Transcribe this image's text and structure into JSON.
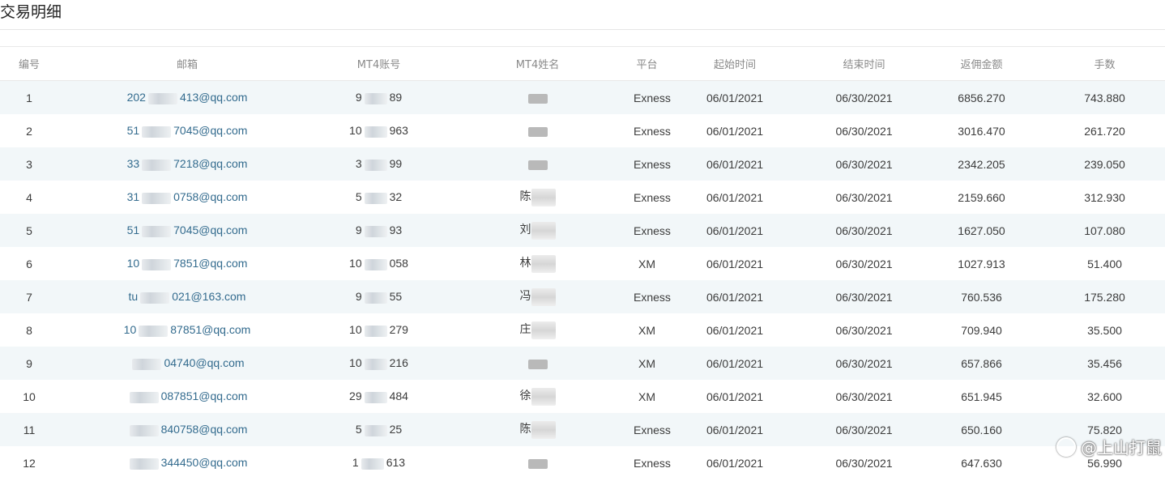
{
  "page": {
    "title": "交易明细"
  },
  "table": {
    "columns": [
      "编号",
      "邮箱",
      "MT4账号",
      "MT4姓名",
      "平台",
      "起始时间",
      "结束时间",
      "返佣金额",
      "手数"
    ],
    "rows": [
      {
        "id": "1",
        "email_start": "202",
        "email_end": "413@qq.com",
        "account_start": "9",
        "account_end": "89",
        "name_start": "",
        "name_end": "",
        "platform": "Exness",
        "start": "06/01/2021",
        "end": "06/30/2021",
        "rebate": "6856.270",
        "lots": "743.880"
      },
      {
        "id": "2",
        "email_start": "51",
        "email_end": "7045@qq.com",
        "account_start": "10",
        "account_end": "963",
        "name_start": "",
        "name_end": "",
        "platform": "Exness",
        "start": "06/01/2021",
        "end": "06/30/2021",
        "rebate": "3016.470",
        "lots": "261.720"
      },
      {
        "id": "3",
        "email_start": "33",
        "email_end": "7218@qq.com",
        "account_start": "3",
        "account_end": "99",
        "name_start": "",
        "name_end": "",
        "platform": "Exness",
        "start": "06/01/2021",
        "end": "06/30/2021",
        "rebate": "2342.205",
        "lots": "239.050"
      },
      {
        "id": "4",
        "email_start": "31",
        "email_end": "0758@qq.com",
        "account_start": "5",
        "account_end": "32",
        "name_start": "陈",
        "name_end": "",
        "platform": "Exness",
        "start": "06/01/2021",
        "end": "06/30/2021",
        "rebate": "2159.660",
        "lots": "312.930"
      },
      {
        "id": "5",
        "email_start": "51",
        "email_end": "7045@qq.com",
        "account_start": "9",
        "account_end": "93",
        "name_start": "刘",
        "name_end": "",
        "platform": "Exness",
        "start": "06/01/2021",
        "end": "06/30/2021",
        "rebate": "1627.050",
        "lots": "107.080"
      },
      {
        "id": "6",
        "email_start": "10",
        "email_end": "7851@qq.com",
        "account_start": "10",
        "account_end": "058",
        "name_start": "林",
        "name_end": "",
        "platform": "XM",
        "start": "06/01/2021",
        "end": "06/30/2021",
        "rebate": "1027.913",
        "lots": "51.400"
      },
      {
        "id": "7",
        "email_start": "tu",
        "email_end": "021@163.com",
        "account_start": "9",
        "account_end": "55",
        "name_start": "冯",
        "name_end": "",
        "platform": "Exness",
        "start": "06/01/2021",
        "end": "06/30/2021",
        "rebate": "760.536",
        "lots": "175.280"
      },
      {
        "id": "8",
        "email_start": "10",
        "email_end": "87851@qq.com",
        "account_start": "10",
        "account_end": "279",
        "name_start": "庄",
        "name_end": "",
        "platform": "XM",
        "start": "06/01/2021",
        "end": "06/30/2021",
        "rebate": "709.940",
        "lots": "35.500"
      },
      {
        "id": "9",
        "email_start": "",
        "email_end": "04740@qq.com",
        "account_start": "10",
        "account_end": "216",
        "name_start": "",
        "name_end": "",
        "platform": "XM",
        "start": "06/01/2021",
        "end": "06/30/2021",
        "rebate": "657.866",
        "lots": "35.456"
      },
      {
        "id": "10",
        "email_start": "",
        "email_end": "087851@qq.com",
        "account_start": "29",
        "account_end": "484",
        "name_start": "徐",
        "name_end": "",
        "platform": "XM",
        "start": "06/01/2021",
        "end": "06/30/2021",
        "rebate": "651.945",
        "lots": "32.600"
      },
      {
        "id": "11",
        "email_start": "",
        "email_end": "840758@qq.com",
        "account_start": "5",
        "account_end": "25",
        "name_start": "陈",
        "name_end": "",
        "platform": "Exness",
        "start": "06/01/2021",
        "end": "06/30/2021",
        "rebate": "650.160",
        "lots": "75.820"
      },
      {
        "id": "12",
        "email_start": "",
        "email_end": "344450@qq.com",
        "account_start": "1",
        "account_end": "613",
        "name_start": "",
        "name_end": "",
        "platform": "Exness",
        "start": "06/01/2021",
        "end": "06/30/2021",
        "rebate": "647.630",
        "lots": "56.990"
      }
    ]
  },
  "watermark": {
    "text": "@上山打鼠",
    "icon": "zhihu-logo-icon"
  }
}
